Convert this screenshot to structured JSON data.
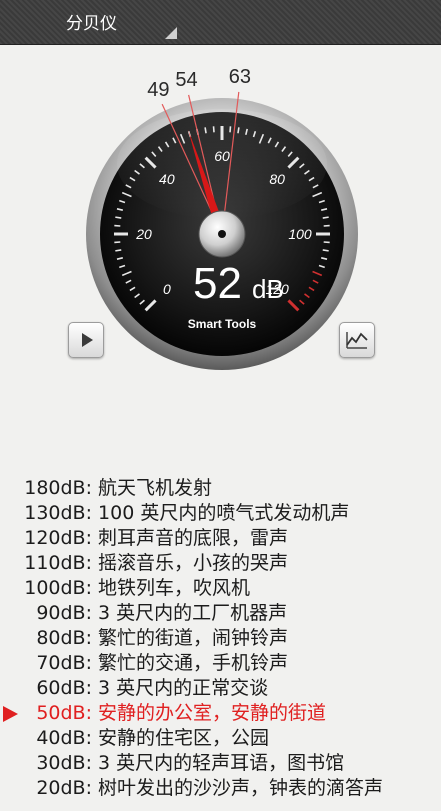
{
  "app": {
    "title": "分贝仪"
  },
  "meter": {
    "reading": "52",
    "unit": "dB",
    "brand": "Smart Tools",
    "needle_db": 52,
    "scale": {
      "min": 0,
      "max": 120,
      "major_step": 20
    },
    "markers": [
      {
        "label": "49",
        "db": 49
      },
      {
        "label": "54",
        "db": 54
      },
      {
        "label": "63",
        "db": 63
      }
    ],
    "colors": {
      "face": "#121212",
      "needle": "#d81818",
      "labels": "#ffffff",
      "tick_red": "#d03030"
    }
  },
  "controls": {
    "play_icon": "play-icon",
    "chart_icon": "line-chart-icon"
  },
  "reference": [
    {
      "level": "180dB:",
      "desc": "航天飞机发射",
      "active": false
    },
    {
      "level": "130dB:",
      "desc": "100 英尺内的喷气式发动机声",
      "active": false
    },
    {
      "level": "120dB:",
      "desc": "刺耳声音的底限，雷声",
      "active": false
    },
    {
      "level": "110dB:",
      "desc": "摇滚音乐，小孩的哭声",
      "active": false
    },
    {
      "level": "100dB:",
      "desc": "地铁列车，吹风机",
      "active": false
    },
    {
      "level": "90dB:",
      "desc": "3 英尺内的工厂机器声",
      "active": false
    },
    {
      "level": "80dB:",
      "desc": "繁忙的街道，闹钟铃声",
      "active": false
    },
    {
      "level": "70dB:",
      "desc": "繁忙的交通，手机铃声",
      "active": false
    },
    {
      "level": "60dB:",
      "desc": "3 英尺内的正常交谈",
      "active": false
    },
    {
      "level": "50dB:",
      "desc": "安静的办公室，安静的街道",
      "active": true
    },
    {
      "level": "40dB:",
      "desc": "安静的住宅区，公园",
      "active": false
    },
    {
      "level": "30dB:",
      "desc": "3 英尺内的轻声耳语，图书馆",
      "active": false
    },
    {
      "level": "20dB:",
      "desc": "树叶发出的沙沙声，钟表的滴答声",
      "active": false
    }
  ]
}
